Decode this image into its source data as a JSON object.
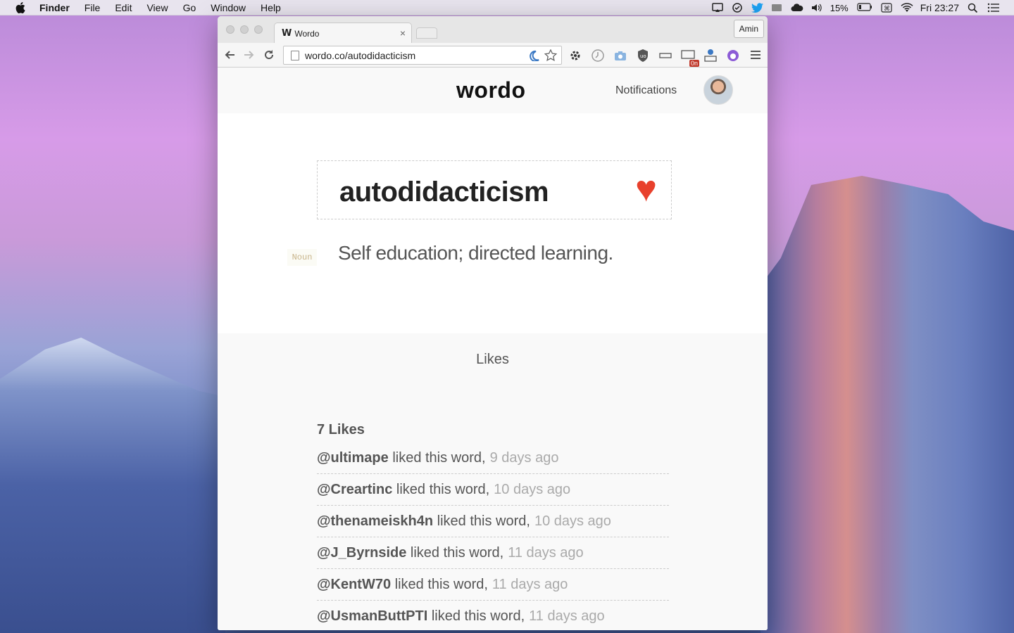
{
  "menubar": {
    "app_name": "Finder",
    "items": [
      "File",
      "Edit",
      "View",
      "Go",
      "Window",
      "Help"
    ],
    "battery": "15%",
    "clock": "Fri 23:27"
  },
  "browser": {
    "tab_title": "Wordo",
    "tab_favicon": "W",
    "profile": "Amin",
    "url": "wordo.co/autodidacticism",
    "extension_badge": "0n"
  },
  "site": {
    "logo": "wordo",
    "notifications": "Notifications"
  },
  "word": {
    "text": "autodidacticism",
    "part_of_speech": "Noun",
    "definition": "Self education; directed learning.",
    "heart_color": "#e8402c"
  },
  "likes": {
    "title": "Likes",
    "count_label": "7 Likes",
    "items": [
      {
        "user": "@ultimape",
        "text": "liked this word,",
        "time": "9 days ago"
      },
      {
        "user": "@Creartinc",
        "text": "liked this word,",
        "time": "10 days ago"
      },
      {
        "user": "@thenameiskh4n",
        "text": "liked this word,",
        "time": "10 days ago"
      },
      {
        "user": "@J_Byrnside",
        "text": "liked this word,",
        "time": "11 days ago"
      },
      {
        "user": "@KentW70",
        "text": "liked this word,",
        "time": "11 days ago"
      },
      {
        "user": "@UsmanButtPTI",
        "text": "liked this word,",
        "time": "11 days ago"
      }
    ]
  }
}
